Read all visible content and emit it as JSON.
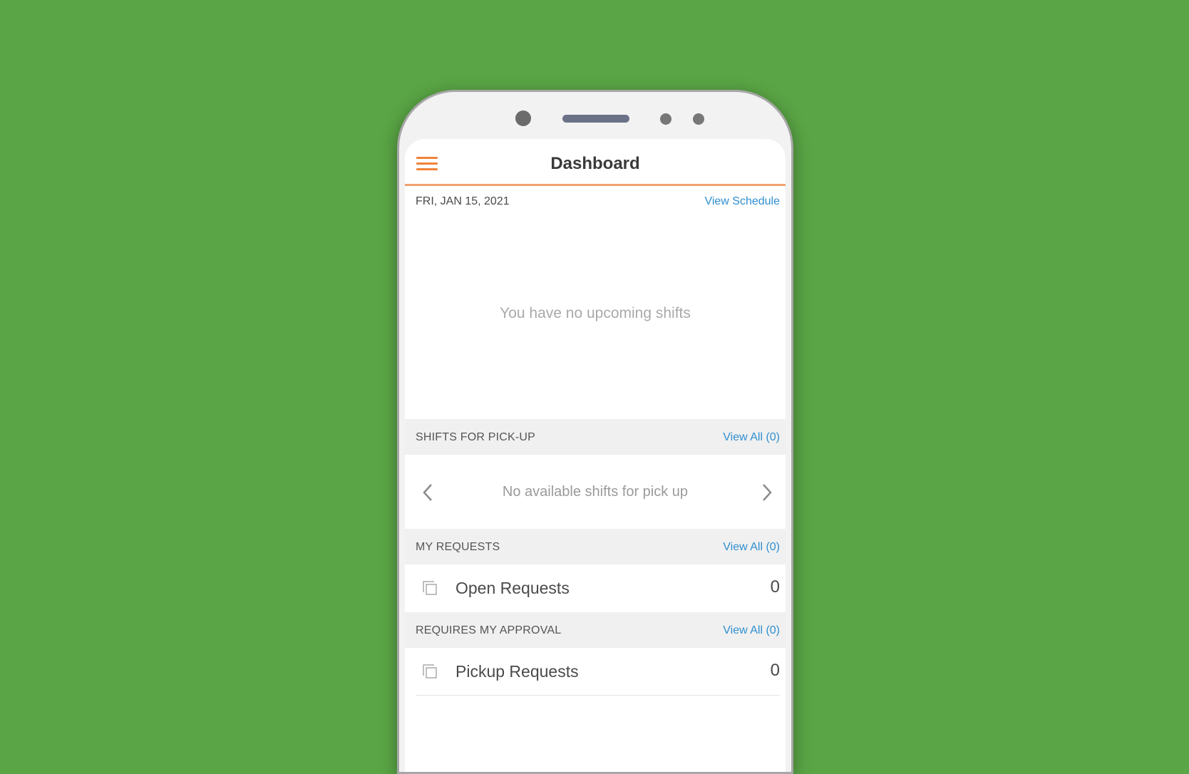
{
  "header": {
    "title": "Dashboard"
  },
  "schedule": {
    "date": "FRI, JAN 15, 2021",
    "view_link": "View Schedule",
    "empty_text": "You have no upcoming shifts"
  },
  "pickup": {
    "section_label": "SHIFTS FOR PICK-UP",
    "view_all": "View All (0)",
    "empty_text": "No available shifts for pick up"
  },
  "my_requests": {
    "section_label": "MY REQUESTS",
    "view_all": "View All (0)",
    "items": [
      {
        "label": "Open Requests",
        "count": "0"
      }
    ]
  },
  "approval": {
    "section_label": "REQUIRES MY APPROVAL",
    "view_all": "View All (0)",
    "items": [
      {
        "label": "Pickup Requests",
        "count": "0"
      }
    ]
  },
  "colors": {
    "background": "#5aa545",
    "accent": "#f0843a",
    "link": "#2f8fd0"
  },
  "icons": {
    "menu": "hamburger-menu-icon",
    "prev": "chevron-left-icon",
    "next": "chevron-right-icon",
    "request": "copy-icon"
  }
}
